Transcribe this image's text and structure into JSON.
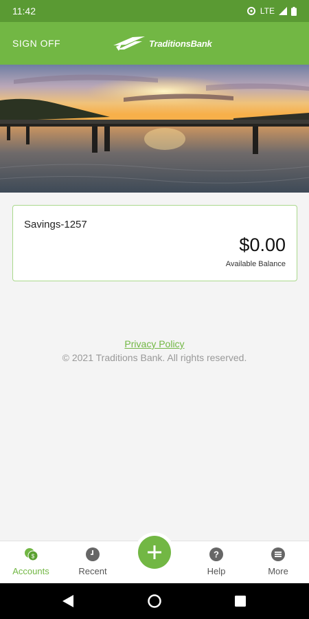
{
  "status": {
    "time": "11:42",
    "network": "LTE",
    "icons": [
      "data-saver-icon",
      "signal-icon",
      "battery-icon"
    ]
  },
  "header": {
    "sign_off_label": "SIGN OFF",
    "logo_text": "TraditionsBank"
  },
  "hero": {
    "icon": "sunset-bridge-photo"
  },
  "account": {
    "name": "Savings-1257",
    "balance": "$0.00",
    "balance_label": "Available Balance"
  },
  "footer": {
    "privacy_label": "Privacy Policy",
    "copyright": "© 2021 Traditions Bank. All rights reserved."
  },
  "tabs": [
    {
      "label": "Accounts",
      "icon": "accounts-icon",
      "active": true
    },
    {
      "label": "Recent",
      "icon": "clock-icon",
      "active": false
    },
    {
      "label": "",
      "icon": "plus-icon",
      "active": false
    },
    {
      "label": "Help",
      "icon": "help-icon",
      "active": false
    },
    {
      "label": "More",
      "icon": "menu-icon",
      "active": false
    }
  ],
  "colors": {
    "brand_green": "#72b744",
    "status_green": "#5a9a33",
    "card_border": "#a9d88b",
    "background": "#f4f4f4"
  }
}
